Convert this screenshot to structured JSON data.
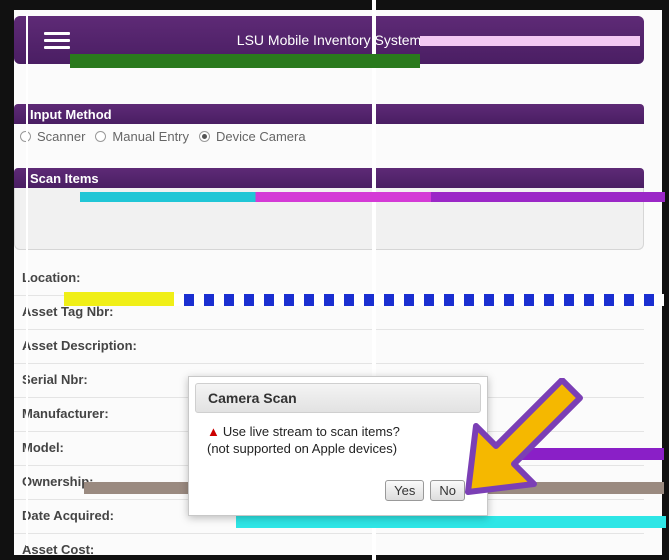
{
  "header": {
    "title": "LSU Mobile Inventory System",
    "menu_icon": "hamburger-icon",
    "color": "#4f2168"
  },
  "input_method": {
    "title": "Input Method",
    "options": [
      {
        "label": "Scanner",
        "selected": false
      },
      {
        "label": "Manual Entry",
        "selected": false
      },
      {
        "label": "Device Camera",
        "selected": true
      }
    ]
  },
  "scan_items": {
    "title": "Scan Items"
  },
  "fields": [
    {
      "label": "Location:"
    },
    {
      "label": "Asset Tag Nbr:"
    },
    {
      "label": "Asset Description:"
    },
    {
      "label": "Serial Nbr:"
    },
    {
      "label": "Manufacturer:"
    },
    {
      "label": "Model:"
    },
    {
      "label": "Ownership:"
    },
    {
      "label": "Date Acquired:"
    },
    {
      "label": "Asset Cost:"
    }
  ],
  "dialog": {
    "title": "Camera Scan",
    "message_line1": "Use live stream to scan items?",
    "message_line2": "(not supported on Apple devices)",
    "warning_icon": "warning-icon",
    "yes_label": "Yes",
    "no_label": "No"
  },
  "annotation": {
    "arrow_icon": "arrow-icon",
    "arrow_color": "#f5b800",
    "arrow_outline": "#7b3fb5"
  }
}
